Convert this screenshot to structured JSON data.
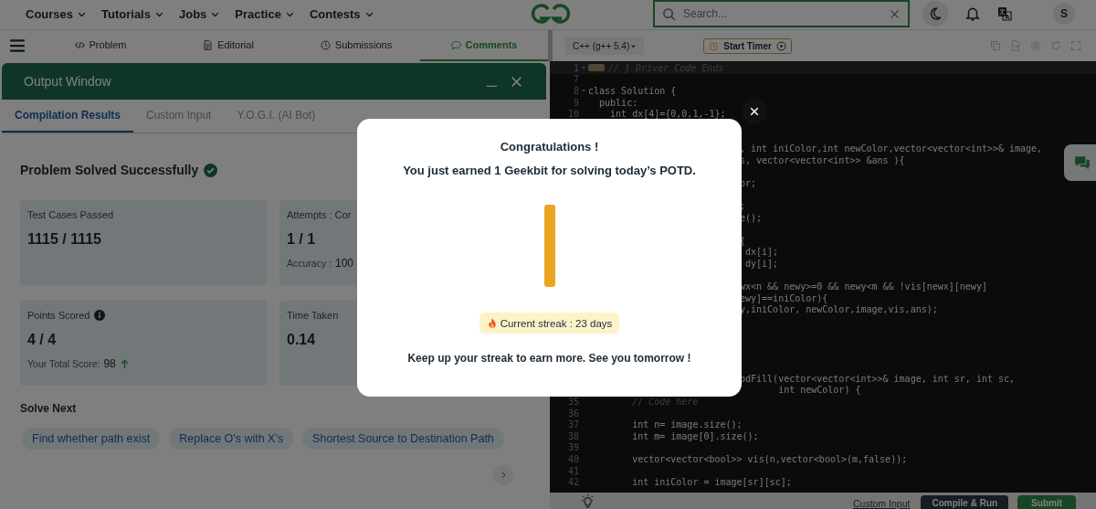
{
  "top_nav": {
    "menus": [
      {
        "label": "Courses"
      },
      {
        "label": "Tutorials"
      },
      {
        "label": "Jobs"
      },
      {
        "label": "Practice"
      },
      {
        "label": "Contests"
      }
    ],
    "search": {
      "placeholder": "Search..."
    },
    "avatar": "S"
  },
  "sub_nav": {
    "tabs": [
      {
        "label": "Problem",
        "selected": false
      },
      {
        "label": "Editorial",
        "selected": false
      },
      {
        "label": "Submissions",
        "selected": false
      },
      {
        "label": "Comments",
        "selected": true
      }
    ],
    "language": "C++ (g++ 5.4)",
    "timer_button": "Start Timer"
  },
  "output_window": {
    "title": "Output Window",
    "tabs": [
      {
        "label": "Compilation Results",
        "selected": true
      },
      {
        "label": "Custom Input",
        "selected": false
      },
      {
        "label": "Y.O.G.I. (AI Bot)",
        "selected": false
      }
    ],
    "status": "Problem Solved Successfully",
    "cards": [
      {
        "label": "Test Cases Passed",
        "value": "1115 / 1115"
      },
      {
        "label": "Attempts : Cor",
        "value": "1 / 1",
        "note_label": "Accuracy :",
        "note_value": "100"
      },
      {
        "label": "Points Scored",
        "info": true,
        "value": "4 / 4",
        "note_label": "Your Total Score:",
        "note_value": "98",
        "rising": true
      },
      {
        "label": "Time Taken",
        "value": "0.14"
      }
    ],
    "solve_next": {
      "title": "Solve Next",
      "items": [
        "Find whether path exist",
        "Replace O's with X's",
        "Shortest Source to Destination Path"
      ]
    }
  },
  "editor": {
    "lines": [
      {
        "kind": "comment",
        "number": "1",
        "fold": true,
        "folded": true,
        "text": "// } Driver Code Ends"
      },
      {
        "kind": "code",
        "number": "7"
      },
      {
        "kind": "code",
        "number": "8",
        "fold": true,
        "text": "class Solution {"
      },
      {
        "kind": "code",
        "number": "9",
        "text": "  public:"
      },
      {
        "kind": "code",
        "number": "10",
        "text": "    int dx[4]={0,0,1,-1};"
      },
      {
        "kind": "covered"
      },
      {
        "kind": "covered"
      },
      {
        "kind": "covered",
        "text": ", int iniColor,int newColor,vector<vector<int>>& image,"
      },
      {
        "kind": "covered",
        "text": "s, vector<vector<int>> &ans ){"
      },
      {
        "kind": "covered"
      },
      {
        "kind": "covered",
        "text": "or;"
      },
      {
        "kind": "covered"
      },
      {
        "kind": "covered",
        "text": ";"
      },
      {
        "kind": "covered",
        "text": "e();"
      },
      {
        "kind": "covered"
      },
      {
        "kind": "covered",
        "text": "{"
      },
      {
        "kind": "covered",
        "text": " dx[i];"
      },
      {
        "kind": "covered",
        "text": " dy[i];"
      },
      {
        "kind": "covered"
      },
      {
        "kind": "covered",
        "text": "wx<n && newy>=0 && newy<m && !vis[newx][newy]"
      },
      {
        "kind": "covered",
        "text": "ewy]==iniColor){"
      },
      {
        "kind": "covered",
        "text": "y,iniColor, newColor,image,vis,ans);"
      },
      {
        "kind": "covered"
      },
      {
        "kind": "covered"
      },
      {
        "kind": "covered"
      },
      {
        "kind": "covered"
      },
      {
        "kind": "covered"
      },
      {
        "kind": "covered",
        "text": "odFill(vector<vector<int>>& image, int sr, int sc,"
      },
      {
        "kind": "covered",
        "text": "       int newColor) {"
      },
      {
        "kind": "comment",
        "number": "35",
        "text": "        // Code here"
      },
      {
        "kind": "code",
        "number": "36"
      },
      {
        "kind": "code",
        "number": "37",
        "text": "        int n= image.size();"
      },
      {
        "kind": "code",
        "number": "38",
        "text": "        int m= image[0].size();"
      },
      {
        "kind": "code",
        "number": "39"
      },
      {
        "kind": "code",
        "number": "40",
        "text": "        vector<vector<bool>> vis(n,vector<bool>(m,false));"
      },
      {
        "kind": "code",
        "number": "41"
      },
      {
        "kind": "code",
        "number": "42",
        "text": "        int iniColor = image[sr][sc];"
      }
    ]
  },
  "bottom_bar": {
    "custom_input": "Custom Input",
    "compile_button": "Compile & Run",
    "submit_button": "Submit"
  },
  "modal": {
    "title": "Congratulations !",
    "message": "You just earned 1 Geekbit for solving today’s POTD.",
    "streak": "Current streak : 23 days",
    "footer": "Keep up your streak to earn more. See you tomorrow !"
  }
}
